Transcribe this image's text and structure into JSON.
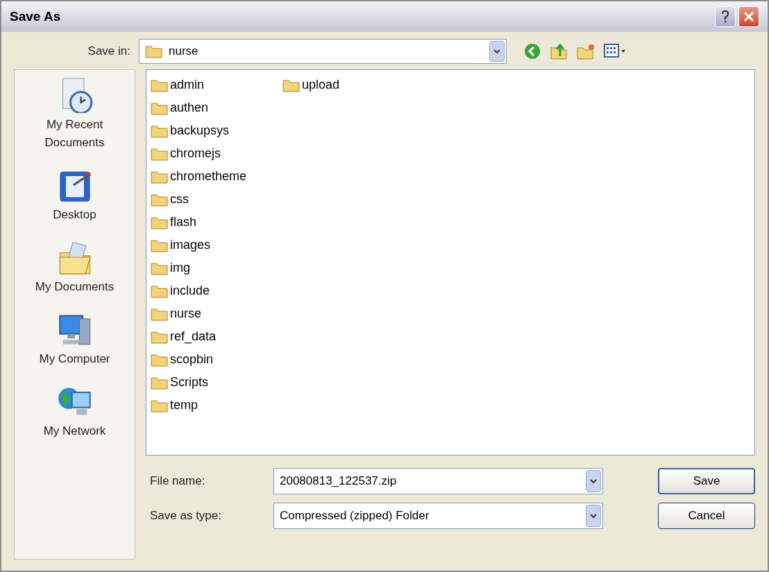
{
  "window": {
    "title": "Save As"
  },
  "save_in": {
    "label": "Save in:",
    "value": "nurse"
  },
  "places": [
    {
      "kind": "recent",
      "label": "My Recent Documents"
    },
    {
      "kind": "desktop",
      "label": "Desktop"
    },
    {
      "kind": "documents",
      "label": "My Documents"
    },
    {
      "kind": "computer",
      "label": "My Computer"
    },
    {
      "kind": "network",
      "label": "My Network"
    }
  ],
  "files": [
    "admin",
    "authen",
    "backupsys",
    "chromejs",
    "chrometheme",
    "css",
    "flash",
    "images",
    "img",
    "include",
    "nurse",
    "ref_data",
    "scopbin",
    "Scripts",
    "temp",
    "upload"
  ],
  "file_name": {
    "label": "File name:",
    "value": "20080813_122537.zip"
  },
  "save_as_type": {
    "label": "Save as type:",
    "value": "Compressed (zipped) Folder"
  },
  "buttons": [
    "Save",
    "Cancel"
  ]
}
